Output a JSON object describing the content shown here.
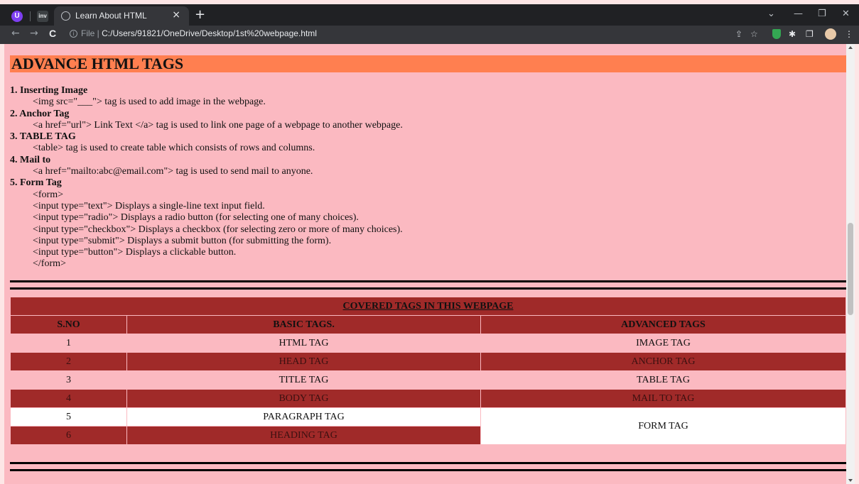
{
  "browser": {
    "tab_title": "Learn About HTML",
    "tab_close": "×",
    "new_tab": "+",
    "ext1": "U",
    "ext2": "inv",
    "url_prefix": "File | ",
    "url": "C:/Users/91821/OneDrive/Desktop/1st%20webpage.html",
    "window_controls": {
      "collapse": "⌄",
      "minimize": "—",
      "restore": "❐",
      "close": "✕"
    },
    "nav": {
      "back": "←",
      "forward": "→",
      "reload": "C"
    },
    "toolbar_icons": {
      "share": "⇪",
      "star": "☆",
      "puzzle": "✱",
      "sidebar": "❐",
      "menu": "⋮"
    }
  },
  "page": {
    "heading": "ADVANCE HTML TAGS",
    "items": [
      {
        "title": "1. Inserting Image",
        "lines": [
          "<img src=\"___\"> tag is used to add image in the webpage."
        ]
      },
      {
        "title": "2. Anchor Tag",
        "lines": [
          "<a href=\"url\"> Link Text </a> tag is used to link one page of a webpage to another webpage."
        ]
      },
      {
        "title": "3. TABLE TAG",
        "lines": [
          "<table> tag is used to create table which consists of rows and columns."
        ]
      },
      {
        "title": "4. Mail to",
        "lines": [
          "<a href=\"mailto:abc@email.com\"> tag is used to send mail to anyone."
        ]
      },
      {
        "title": "5. Form Tag",
        "lines": [
          "<form>",
          "<input type=\"text\"> Displays a single-line text input field.",
          "<input type=\"radio\"> Displays a radio button (for selecting one of many choices).",
          "<input type=\"checkbox\"> Displays a checkbox (for selecting zero or more of many choices).",
          "<input type=\"submit\"> Displays a submit button (for submitting the form).",
          "<input type=\"button\"> Displays a clickable button.",
          "</form>"
        ]
      }
    ],
    "table": {
      "caption": "COVERED TAGS IN THIS WEBPAGE",
      "headers": [
        "S.NO",
        "BASIC TAGS.",
        "ADVANCED TAGS"
      ],
      "rows": [
        [
          "1",
          "HTML TAG",
          "IMAGE TAG"
        ],
        [
          "2",
          "HEAD TAG",
          "ANCHOR TAG"
        ],
        [
          "3",
          "TITLE TAG",
          "TABLE TAG"
        ],
        [
          "4",
          "BODY TAG",
          "MAIL TO TAG"
        ],
        [
          "5",
          "PARAGRAPH TAG",
          "FORM TAG"
        ],
        [
          "6",
          "HEADING TAG",
          ""
        ]
      ]
    }
  },
  "colors": {
    "page_bg": "#fbb9c1",
    "heading_bg": "#ff7f50",
    "dark_row": "#a02a29"
  }
}
